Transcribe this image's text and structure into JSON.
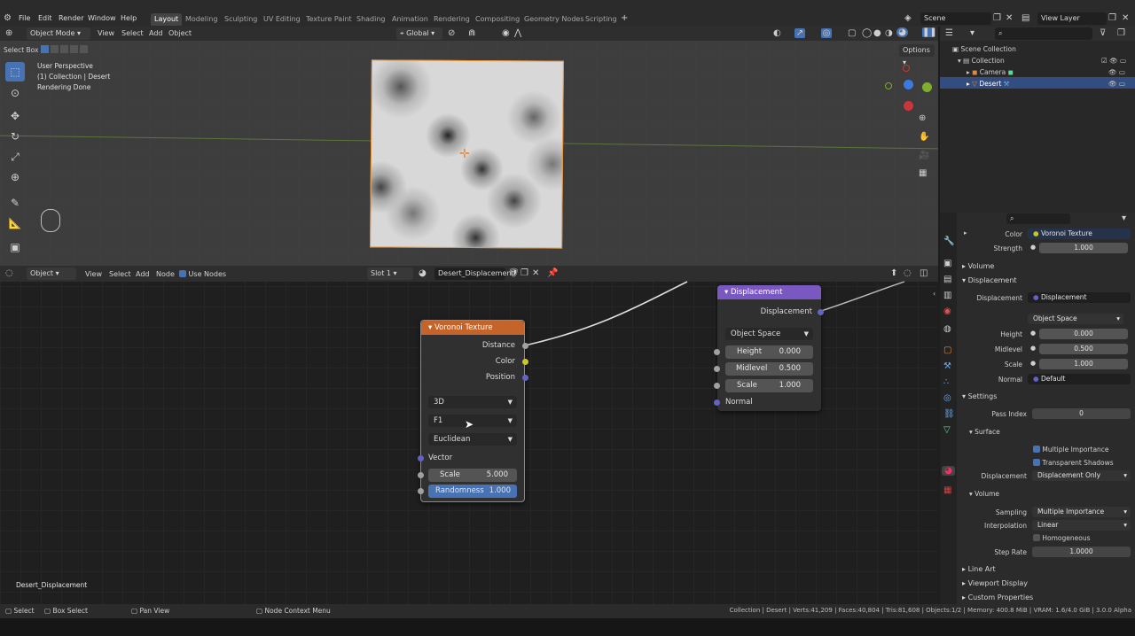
{
  "menu": [
    "File",
    "Edit",
    "Render",
    "Window",
    "Help"
  ],
  "workspaces": [
    "Layout",
    "Modeling",
    "Sculpting",
    "UV Editing",
    "Texture Paint",
    "Shading",
    "Animation",
    "Rendering",
    "Compositing",
    "Geometry Nodes",
    "Scripting"
  ],
  "active_workspace": "Layout",
  "scene": "Scene",
  "view_layer": "View Layer",
  "viewport": {
    "mode": "Object Mode",
    "menus": [
      "View",
      "Select",
      "Add",
      "Object"
    ],
    "transform": "Global",
    "options": "Options",
    "tool_label": "Select Box",
    "info": [
      "User Perspective",
      "(1) Collection | Desert",
      "Rendering Done"
    ]
  },
  "outliner": {
    "items": [
      "Scene Collection",
      "Collection",
      "Camera",
      "Desert"
    ]
  },
  "node_editor": {
    "type": "Object",
    "menus": [
      "View",
      "Select",
      "Add",
      "Node"
    ],
    "use_nodes": "Use Nodes",
    "slot": "Slot 1",
    "material": "Desert_Displacement",
    "material_footer": "Desert_Displacement",
    "voronoi": {
      "title": "Voronoi Texture",
      "outputs": [
        "Distance",
        "Color",
        "Position"
      ],
      "dims": "3D",
      "feature": "F1",
      "metric": "Euclidean",
      "vector": "Vector",
      "scale_label": "Scale",
      "scale": "5.000",
      "rand_label": "Randomness",
      "rand": "1.000"
    },
    "displacement": {
      "title": "Displacement",
      "output": "Displacement",
      "space": "Object Space",
      "height_label": "Height",
      "height": "0.000",
      "mid_label": "Midlevel",
      "mid": "0.500",
      "scale_label": "Scale",
      "scale": "1.000",
      "normal": "Normal"
    }
  },
  "props": {
    "color_label": "Color",
    "color_val": "Voronoi Texture",
    "strength_label": "Strength",
    "strength": "1.000",
    "volume": "Volume",
    "displacement_sec": "Displacement",
    "disp_label": "Displacement",
    "disp_val": "Displacement",
    "space": "Object Space",
    "height_label": "Height",
    "height": "0.000",
    "mid_label": "Midlevel",
    "mid": "0.500",
    "scale_label": "Scale",
    "scale": "1.000",
    "normal_label": "Normal",
    "normal_val": "Default",
    "settings": "Settings",
    "pass_label": "Pass Index",
    "pass": "0",
    "surface": "Surface",
    "mi": "Multiple Importance",
    "ts": "Transparent Shadows",
    "disp2_label": "Displacement",
    "disp2": "Displacement Only",
    "volume2": "Volume",
    "sampling_label": "Sampling",
    "sampling": "Multiple Importance",
    "interp_label": "Interpolation",
    "interp": "Linear",
    "homog": "Homogeneous",
    "step_label": "Step Rate",
    "step": "1.0000",
    "line_art": "Line Art",
    "viewport_display": "Viewport Display",
    "custom": "Custom Properties"
  },
  "status": {
    "select": "Select",
    "box": "Box Select",
    "pan": "Pan View",
    "ctx": "Node Context Menu",
    "stats": "Collection | Desert | Verts:41,209 | Faces:40,804 | Tris:81,608 | Objects:1/2 | Memory: 400.8 MiB | VRAM: 1.6/4.0 GiB | 3.0.0 Alpha"
  },
  "colors": {
    "voronoi_head": "#c5642a",
    "disp_head": "#7a58c2",
    "selection": "#4772b3",
    "accent": "#5680c2"
  }
}
